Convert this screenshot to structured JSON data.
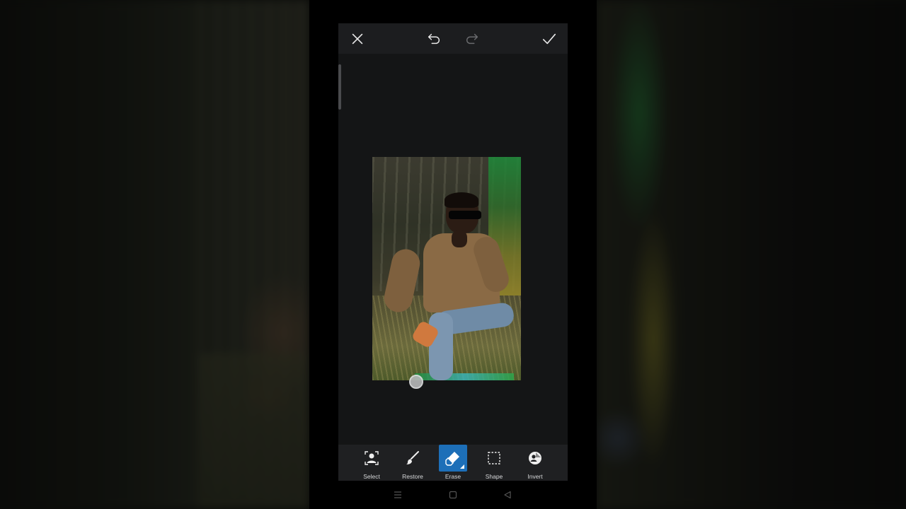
{
  "topbar": {
    "close_icon": "close-icon",
    "undo_icon": "undo-icon",
    "redo_icon": "redo-icon",
    "apply_icon": "check-icon"
  },
  "toolbar": {
    "tools": [
      {
        "id": "select",
        "label": "Select",
        "icon": "person-select-icon",
        "active": false
      },
      {
        "id": "restore",
        "label": "Restore",
        "icon": "brush-icon",
        "active": false
      },
      {
        "id": "erase",
        "label": "Erase",
        "icon": "eraser-icon",
        "active": true
      },
      {
        "id": "shape",
        "label": "Shape",
        "icon": "dashed-rect-icon",
        "active": false
      },
      {
        "id": "invert",
        "label": "Invert",
        "icon": "invert-icon",
        "active": false
      }
    ]
  },
  "colors": {
    "accent": "#1d6fb8",
    "app_bg": "#141516",
    "toolbar_bg": "#1f2022"
  },
  "navbar": {
    "menu_icon": "menu-icon",
    "home_icon": "home-square-icon",
    "back_icon": "back-triangle-icon"
  }
}
